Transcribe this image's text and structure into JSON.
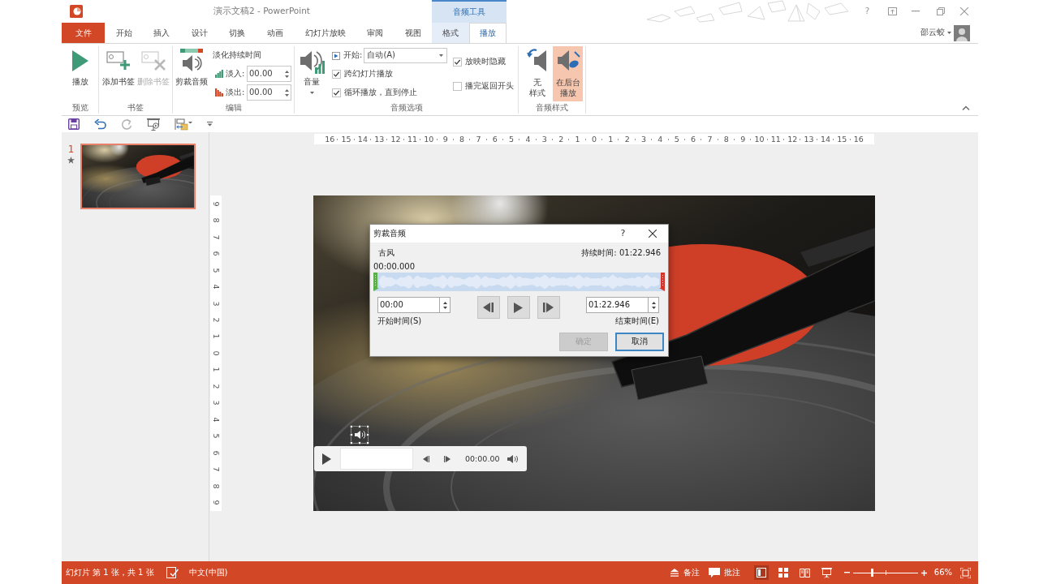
{
  "window": {
    "title": "演示文稿2 - PowerPoint",
    "help": "?"
  },
  "tool_group": {
    "label": "音频工具"
  },
  "tabs": [
    {
      "label": "文件",
      "kind": "file",
      "selected": false
    },
    {
      "label": "开始",
      "kind": "main",
      "selected": false
    },
    {
      "label": "插入",
      "kind": "main",
      "selected": false
    },
    {
      "label": "设计",
      "kind": "main",
      "selected": false
    },
    {
      "label": "切换",
      "kind": "main",
      "selected": false
    },
    {
      "label": "动画",
      "kind": "main",
      "selected": false
    },
    {
      "label": "幻灯片放映",
      "kind": "main",
      "selected": false
    },
    {
      "label": "审阅",
      "kind": "main",
      "selected": false
    },
    {
      "label": "视图",
      "kind": "main",
      "selected": false
    },
    {
      "label": "格式",
      "kind": "tool",
      "selected": false
    },
    {
      "label": "播放",
      "kind": "tool",
      "selected": true
    }
  ],
  "account": {
    "name": "邵云蛟"
  },
  "ribbon": {
    "preview": {
      "label": "预览",
      "play": "播放"
    },
    "bookmarks": {
      "label": "书签",
      "buttons": [
        {
          "label": "添加书签",
          "disabled": false
        },
        {
          "label": "删除书签",
          "disabled": true
        }
      ]
    },
    "editing": {
      "label": "编辑",
      "trim": "剪裁音频",
      "fade_title": "淡化持续时间",
      "fades": [
        {
          "label": "淡入:",
          "value": "00.00"
        },
        {
          "label": "淡出:",
          "value": "00.00"
        }
      ]
    },
    "audio_options": {
      "label": "音频选项",
      "volume": "音量",
      "start": {
        "label": "开始:",
        "value": "自动(A)"
      },
      "checkboxes": [
        {
          "label": "跨幻灯片播放",
          "checked": true
        },
        {
          "label": "循环播放，直到停止",
          "checked": true
        },
        {
          "label": "放映时隐藏",
          "checked": true
        },
        {
          "label": "播完返回开头",
          "checked": false
        }
      ]
    },
    "audio_styles": {
      "label": "音频样式",
      "buttons": [
        {
          "lines": [
            "无",
            "样式"
          ],
          "selected": false
        },
        {
          "lines": [
            "在后台",
            "播放"
          ],
          "selected": true
        }
      ]
    }
  },
  "quick_access": [
    {
      "disabled": false
    },
    {
      "disabled": false
    },
    {
      "disabled": true
    },
    {
      "disabled": false
    },
    {
      "disabled": false
    }
  ],
  "slides": [
    {
      "number": "1",
      "selected": true,
      "animated": true
    }
  ],
  "rulers": {
    "horizontal": [
      "16",
      "15",
      "14",
      "13",
      "12",
      "11",
      "10",
      "9",
      "8",
      "7",
      "6",
      "5",
      "4",
      "3",
      "2",
      "1",
      "0",
      "1",
      "2",
      "3",
      "4",
      "5",
      "6",
      "7",
      "8",
      "9",
      "10",
      "11",
      "12",
      "13",
      "14",
      "15",
      "16"
    ],
    "vertical": [
      "9",
      "8",
      "7",
      "6",
      "5",
      "4",
      "3",
      "2",
      "1",
      "0",
      "1",
      "2",
      "3",
      "4",
      "5",
      "6",
      "7",
      "8",
      "9"
    ]
  },
  "slide": {
    "player": {
      "time": "00:00.00"
    }
  },
  "trim_dialog": {
    "title": "剪裁音频",
    "help": "?",
    "track_name": "古风",
    "duration": "持续时间: 01:22.946",
    "position": "00:00.000",
    "start": {
      "value": "00:00",
      "label": "开始时间(S)"
    },
    "end": {
      "value": "01:22.946",
      "label": "结束时间(E)"
    },
    "buttons": [
      {
        "label": "确定",
        "disabled": true,
        "focused": false
      },
      {
        "label": "取消",
        "disabled": false,
        "focused": true
      }
    ]
  },
  "status_bar": {
    "slide_info": "幻灯片 第 1 张，共 1 张",
    "language": "中文(中国)",
    "notes": "备注",
    "comments": "批注",
    "views": [
      {
        "selected": true
      },
      {
        "selected": false
      },
      {
        "selected": false
      },
      {
        "selected": false
      }
    ],
    "zoom": {
      "level": 0.3,
      "reading": "66%"
    }
  }
}
